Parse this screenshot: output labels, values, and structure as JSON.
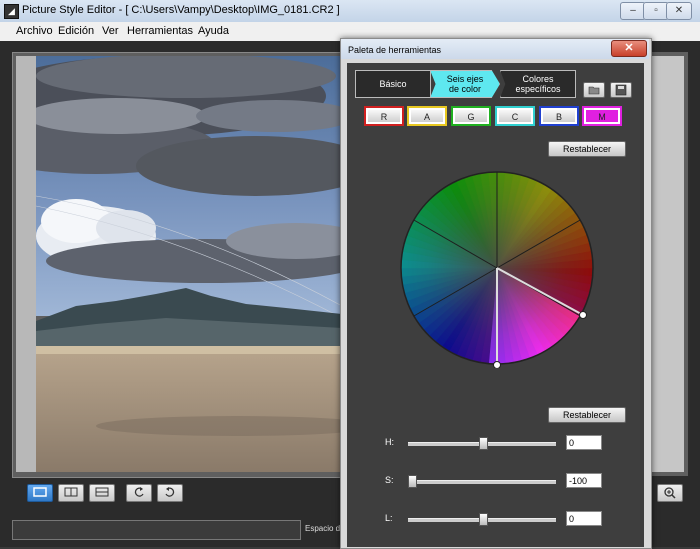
{
  "window": {
    "title": "Picture Style Editor - [ C:\\Users\\Vampy\\Desktop\\IMG_0181.CR2 ]"
  },
  "menu": [
    "Archivo",
    "Edición",
    "Ver",
    "Herramientas",
    "Ayuda"
  ],
  "status": {
    "label": "Espacio de"
  },
  "palette": {
    "title": "Paleta de herramientas",
    "tabs": [
      {
        "line1": "Básico",
        "line2": ""
      },
      {
        "line1": "Seis ejes",
        "line2": "de color"
      },
      {
        "line1": "Colores",
        "line2": "específicos"
      }
    ],
    "color_buttons": [
      {
        "label": "R",
        "color": "#d02020"
      },
      {
        "label": "A",
        "color": "#e8c820"
      },
      {
        "label": "G",
        "color": "#20b020"
      },
      {
        "label": "C",
        "color": "#30d0d0"
      },
      {
        "label": "B",
        "color": "#2040d0"
      },
      {
        "label": "M",
        "color": "#e020e0",
        "selected": true
      }
    ],
    "reset_label": "Restablecer",
    "sliders": [
      {
        "label": "H:",
        "value": "0",
        "level": 0.5
      },
      {
        "label": "S:",
        "value": "-100",
        "level": 0.0
      },
      {
        "label": "L:",
        "value": "0",
        "level": 0.5
      }
    ]
  }
}
